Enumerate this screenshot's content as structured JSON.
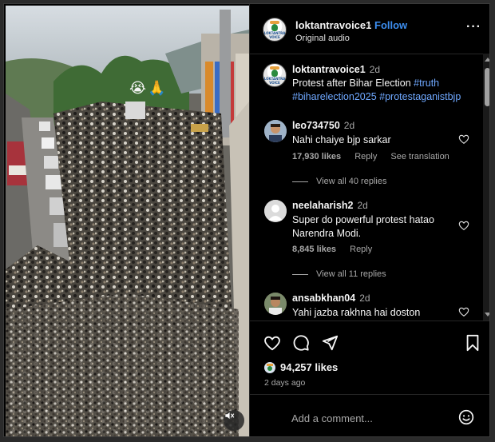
{
  "header": {
    "username": "loktantravoice1",
    "dot": "•",
    "follow_label": "Follow",
    "audio_label": "Original audio",
    "more_label": "···"
  },
  "video": {
    "emoji_overlay": "😭🙏"
  },
  "caption": {
    "username": "loktantravoice1",
    "time": "2d",
    "text": "Protest after Bihar Election ",
    "tags": [
      "#truth",
      "#biharelection2025",
      "#protestaganistbjp"
    ]
  },
  "comments": [
    {
      "username": "leo734750",
      "time": "2d",
      "text": "Nahi chaiye bjp sarkar",
      "likes": "17,930 likes",
      "reply_label": "Reply",
      "translate_label": "See translation",
      "view_replies": "View all 40 replies"
    },
    {
      "username": "neelaharish2",
      "time": "2d",
      "text": "Super do powerful protest hatao Narendra Modi.",
      "likes": "8,845 likes",
      "reply_label": "Reply",
      "view_replies": "View all 11 replies"
    },
    {
      "username": "ansabkhan04",
      "time": "2d",
      "text": "Yahi jazba rakhna hai doston"
    }
  ],
  "post": {
    "likes_count": "94,257 likes",
    "time_ago": "2 days ago"
  },
  "comment_box": {
    "placeholder": "Add a comment..."
  },
  "logo_text": "LOKTANTRA VOICE",
  "colors": {
    "link_blue": "#3c8ef0",
    "hashtag": "#6fa8ff",
    "muted_text": "#a8a8a8",
    "background": "#000000"
  },
  "icons": [
    "heart-icon",
    "comment-icon",
    "share-icon",
    "bookmark-icon",
    "smiley-icon",
    "mute-icon",
    "more-icon"
  ]
}
